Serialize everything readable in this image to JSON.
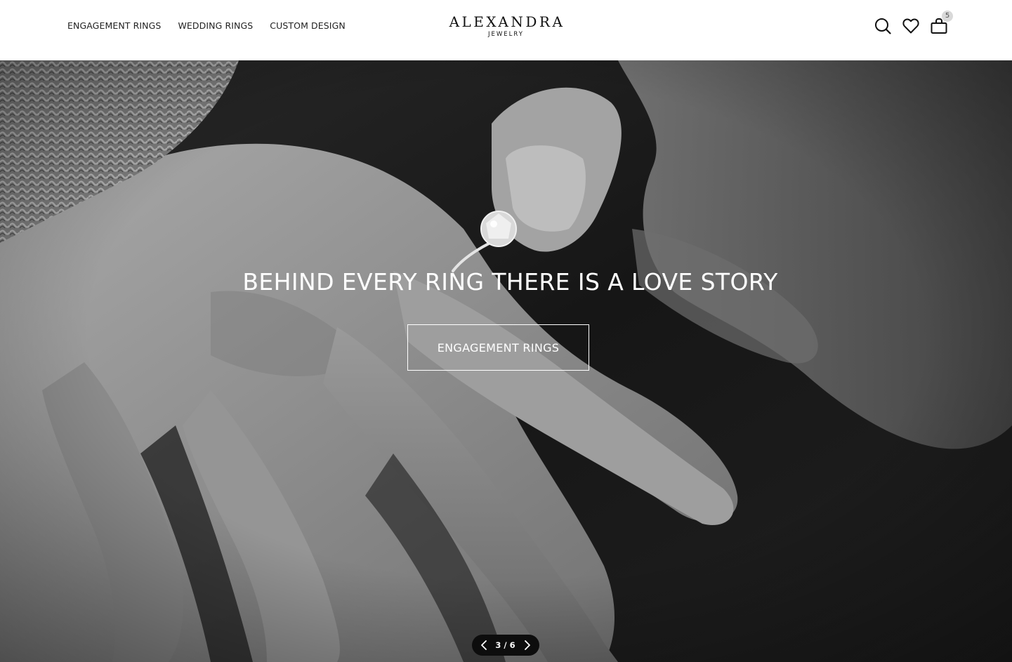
{
  "header": {
    "nav": [
      {
        "label": "ENGAGEMENT RINGS"
      },
      {
        "label": "WEDDING RINGS"
      },
      {
        "label": "CUSTOM DESIGN"
      }
    ],
    "logo": {
      "main": "ALEXANDRA",
      "sub": "JEWELRY"
    },
    "icons": {
      "search": "search-icon",
      "wishlist": "heart-icon",
      "cart": "shopping-bag-icon",
      "cart_count": "5"
    }
  },
  "hero": {
    "title": "BEHIND EVERY RING THERE IS A LOVE STORY",
    "cta_label": "ENGAGEMENT RINGS",
    "image": "black-and-white photo of a hand placing a solitaire diamond ring on a finger"
  },
  "slider": {
    "current": "3",
    "separator": "/",
    "total": "6"
  },
  "colors": {
    "header_bg": "#ffffff",
    "text_dark": "#222222",
    "hero_text": "#ffffff",
    "pager_bg": "#0d0d0d",
    "badge_bg": "#d9d9d9"
  }
}
